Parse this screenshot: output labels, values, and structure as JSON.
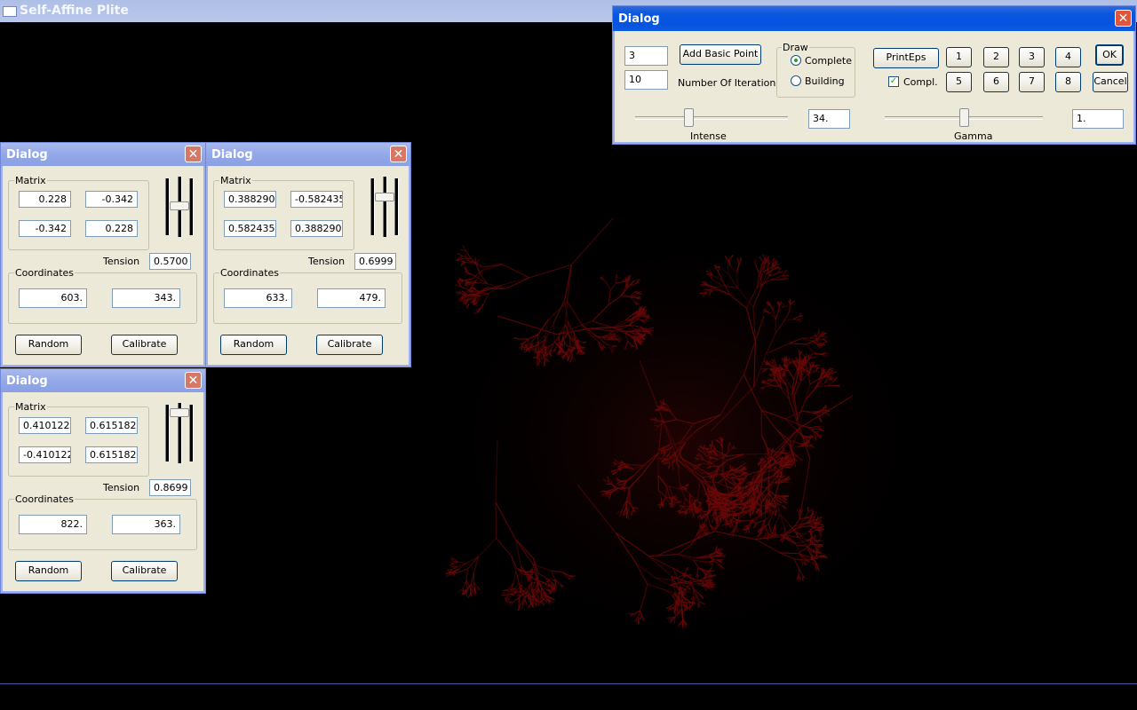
{
  "window": {
    "title": "Self-Affine Plite"
  },
  "main_dialog": {
    "title": "Dialog",
    "basic_point_count": "3",
    "add_basic_point_label": "Add Basic Point",
    "iterations": "10",
    "iterations_label": "Number Of Iteration",
    "draw_group_label": "Draw",
    "draw_options": [
      "Complete",
      "Building"
    ],
    "draw_selected": "Complete",
    "print_eps_label": "PrintEps",
    "compl_label": "Compl.",
    "compl_checked": true,
    "number_buttons": [
      "1",
      "2",
      "3",
      "4",
      "5",
      "6",
      "7",
      "8"
    ],
    "ok_label": "OK",
    "cancel_label": "Cancel",
    "intense_value": "34.",
    "intense_label": "Intense",
    "gamma_value": "1.",
    "gamma_label": "Gamma"
  },
  "transform_dialogs": [
    {
      "title": "Dialog",
      "matrix_label": "Matrix",
      "matrix": [
        "0.228",
        "-0.342",
        "-0.342",
        "0.228"
      ],
      "tension_label": "Tension",
      "tension": "0.5700",
      "coordinates_label": "Coordinates",
      "coordinates": [
        "603.",
        "343."
      ],
      "random_label": "Random",
      "calibrate_label": "Calibrate"
    },
    {
      "title": "Dialog",
      "matrix_label": "Matrix",
      "matrix": [
        "0.388290",
        "-0.582435",
        "0.582435",
        "0.388290"
      ],
      "tension_label": "Tension",
      "tension": "0.6999",
      "coordinates_label": "Coordinates",
      "coordinates": [
        "633.",
        "479."
      ],
      "random_label": "Random",
      "calibrate_label": "Calibrate"
    },
    {
      "title": "Dialog",
      "matrix_label": "Matrix",
      "matrix": [
        "0.410122",
        "0.615182",
        "-0.410122",
        "0.615182"
      ],
      "tension_label": "Tension",
      "tension": "0.8699",
      "coordinates_label": "Coordinates",
      "coordinates": [
        "822.",
        "363."
      ],
      "random_label": "Random",
      "calibrate_label": "Calibrate"
    }
  ],
  "colors": {
    "fractal": "#7a0a0a",
    "title_active": "#0553e1",
    "title_inactive": "#93a8e8",
    "face": "#ece9d8"
  },
  "icons": {
    "close": "close-icon",
    "app": "window-icon"
  }
}
